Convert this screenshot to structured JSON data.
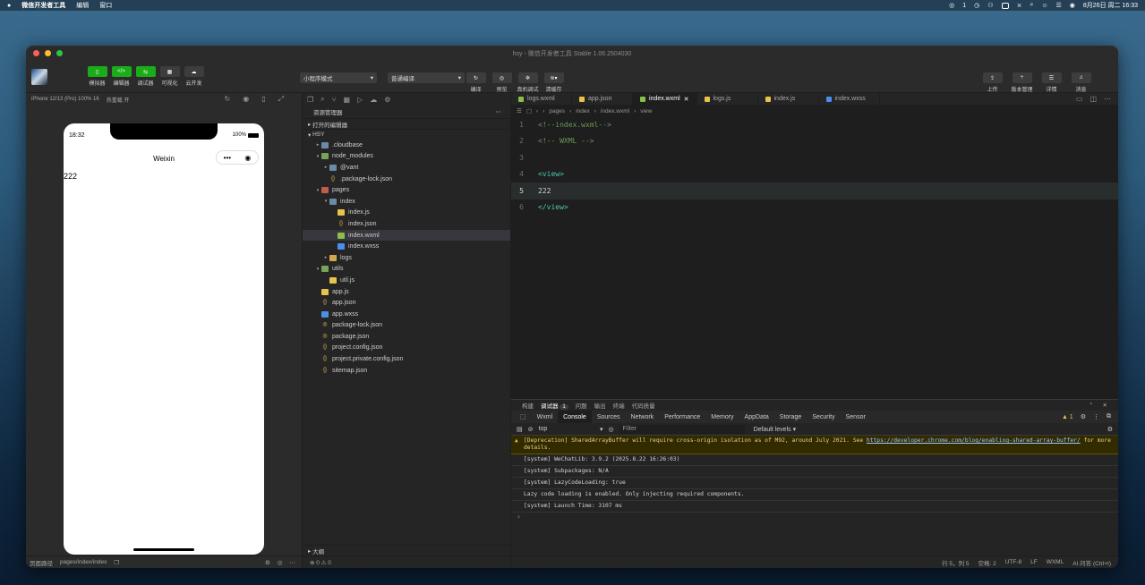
{
  "menubar": {
    "app": "微信开发者工具",
    "items": [
      "编辑",
      "窗口"
    ],
    "datetime": "8月26日 周二 16:33",
    "wechat_count": "1"
  },
  "window": {
    "title": "hsy - 微信开发者工具 Stable 1.06.2504030"
  },
  "toolbar": {
    "buttons": [
      "模拟器",
      "编辑器",
      "调试器",
      "可视化",
      "云开发"
    ],
    "mode_select": "小程序模式",
    "compile_select": "普通编译",
    "mid_buttons": [
      "编译",
      "预览",
      "真机调试",
      "清缓存"
    ],
    "right_buttons": [
      "上传",
      "版本管理",
      "详情",
      "消息"
    ]
  },
  "simulator": {
    "device": "iPhone 12/13 (Pro) 100% 16",
    "hotreload": "热重载 开",
    "status_time": "18:32",
    "battery": "100%",
    "nav_title": "Weixin",
    "body_text": "222",
    "footer_label": "页面路径",
    "footer_path": "pages/index/index"
  },
  "explorer": {
    "title": "资源管理器",
    "open_editors": "打开的编辑器",
    "project": "HSY",
    "outline": "大纲",
    "status": "⊗ 0 ⚠ 0",
    "tree": [
      {
        "name": ".cloudbase",
        "depth": 1,
        "type": "folder",
        "arrow": "▸"
      },
      {
        "name": "node_modules",
        "depth": 1,
        "type": "folder-green",
        "arrow": "▾"
      },
      {
        "name": "@vant",
        "depth": 2,
        "type": "folder",
        "arrow": "▸"
      },
      {
        "name": ".package-lock.json",
        "depth": 2,
        "type": "json",
        "arrow": ""
      },
      {
        "name": "pages",
        "depth": 1,
        "type": "folder-red",
        "arrow": "▾"
      },
      {
        "name": "index",
        "depth": 2,
        "type": "folder",
        "arrow": "▾"
      },
      {
        "name": "index.js",
        "depth": 3,
        "type": "js",
        "arrow": ""
      },
      {
        "name": "index.json",
        "depth": 3,
        "type": "json",
        "arrow": ""
      },
      {
        "name": "index.wxml",
        "depth": 3,
        "type": "wxml",
        "arrow": "",
        "selected": true
      },
      {
        "name": "index.wxss",
        "depth": 3,
        "type": "wxss",
        "arrow": ""
      },
      {
        "name": "logs",
        "depth": 2,
        "type": "folder-yellow",
        "arrow": "▸"
      },
      {
        "name": "utils",
        "depth": 1,
        "type": "folder-green",
        "arrow": "▾"
      },
      {
        "name": "util.js",
        "depth": 2,
        "type": "js",
        "arrow": ""
      },
      {
        "name": "app.js",
        "depth": 1,
        "type": "js",
        "arrow": ""
      },
      {
        "name": "app.json",
        "depth": 1,
        "type": "json",
        "arrow": ""
      },
      {
        "name": "app.wxss",
        "depth": 1,
        "type": "wxss",
        "arrow": ""
      },
      {
        "name": "package-lock.json",
        "depth": 1,
        "type": "pkg",
        "arrow": ""
      },
      {
        "name": "package.json",
        "depth": 1,
        "type": "pkg",
        "arrow": ""
      },
      {
        "name": "project.config.json",
        "depth": 1,
        "type": "json",
        "arrow": ""
      },
      {
        "name": "project.private.config.json",
        "depth": 1,
        "type": "json",
        "arrow": ""
      },
      {
        "name": "sitemap.json",
        "depth": 1,
        "type": "json",
        "arrow": ""
      }
    ]
  },
  "editor": {
    "tabs": [
      {
        "label": "logs.wxml",
        "type": "wxml"
      },
      {
        "label": "app.json",
        "type": "json"
      },
      {
        "label": "index.wxml",
        "type": "wxml",
        "active": true
      },
      {
        "label": "logs.js",
        "type": "js"
      },
      {
        "label": "index.js",
        "type": "js"
      },
      {
        "label": "index.wxss",
        "type": "wxss"
      }
    ],
    "breadcrumb": [
      "pages",
      "index",
      "index.wxml",
      "view"
    ],
    "lines": [
      {
        "n": "1",
        "text": "<!--index.wxml-->",
        "kind": "cmt"
      },
      {
        "n": "2",
        "text": "<!-- WXML -->",
        "kind": "cmt"
      },
      {
        "n": "3",
        "text": "",
        "kind": "txt"
      },
      {
        "n": "4",
        "text": "<view>",
        "kind": "tag"
      },
      {
        "n": "5",
        "text": "222",
        "kind": "txt",
        "current": true
      },
      {
        "n": "6",
        "text": "</view>",
        "kind": "tag"
      }
    ]
  },
  "devtools": {
    "top_tabs": [
      "构建",
      "调试器",
      "问题",
      "输出",
      "终端",
      "代码质量"
    ],
    "debugger_badge": "1",
    "tabs": [
      "Wxml",
      "Console",
      "Sources",
      "Network",
      "Performance",
      "Memory",
      "AppData",
      "Storage",
      "Security",
      "Sensor"
    ],
    "warn_count": "▲ 1",
    "context": "top",
    "filter_placeholder": "Filter",
    "levels": "Default levels ▾",
    "warning_text": "[Deprecation] SharedArrayBuffer will require cross-origin isolation as of M92, around July 2021. See ",
    "warning_link": "https://developer.chrome.com/blog/enabling-shared-array-buffer/",
    "warning_tail": " for more details.",
    "logs": [
      "[system] WeChatLib: 3.9.2 (2025.8.22 16:26:03)",
      "[system] Subpackages: N/A",
      "[system] LazyCodeLoading: true",
      "Lazy code loading is enabled. Only injecting required components.",
      "[system] Launch Time: 3107 ms"
    ]
  },
  "statusbar": [
    "行 5，列 5",
    "空格: 2",
    "UTF-8",
    "LF",
    "WXML",
    "AI 问答 (Ctrl+I)"
  ],
  "colors": {
    "accent_green": "#1aad19",
    "editor_bg": "#1e1e1e"
  }
}
